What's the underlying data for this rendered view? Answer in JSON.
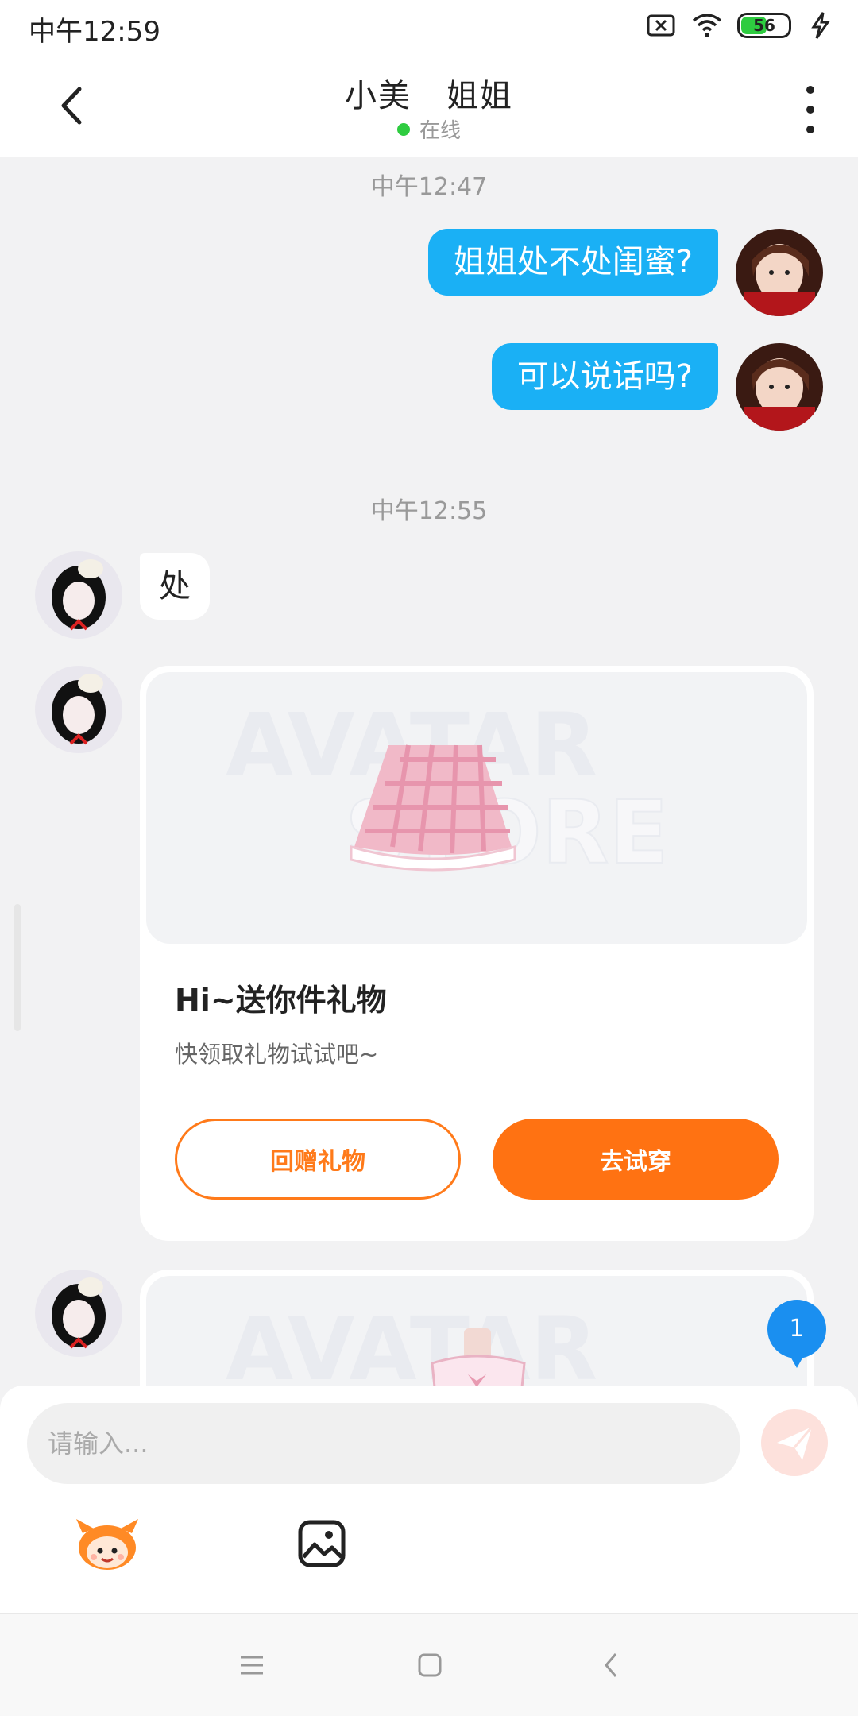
{
  "status_bar": {
    "time": "中午12:59",
    "battery": "56"
  },
  "header": {
    "name_first": "小美",
    "name_second": "姐姐",
    "status": "在线"
  },
  "messages": {
    "ts1": "中午12:47",
    "me_1": "姐姐处不处闺蜜?",
    "me_2": "可以说话吗?",
    "ts2": "中午12:55",
    "other_1": "处"
  },
  "gift_card": {
    "watermark": "AVATAR STORE",
    "title": "Hi~送你件礼物",
    "subtitle": "快领取礼物试试吧~",
    "return_gift": "回赠礼物",
    "try_on": "去试穿"
  },
  "unread_count": "1",
  "composer": {
    "placeholder": "请输入..."
  },
  "colors": {
    "accent": "#ff7212",
    "bubble": "#1ab0f5",
    "online": "#2ecc40"
  }
}
